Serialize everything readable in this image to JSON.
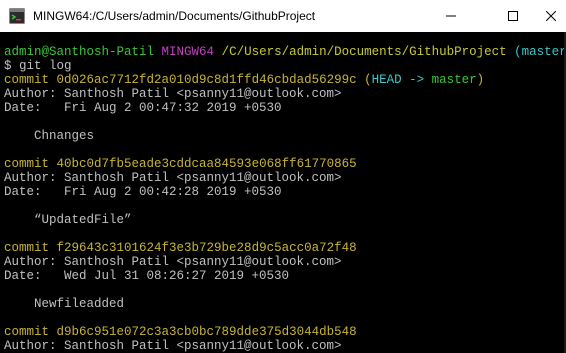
{
  "window": {
    "title": "MINGW64:/C/Users/admin/Documents/GithubProject",
    "icon": "git-bash-icon",
    "controls": [
      "minimize-icon",
      "maximize-icon",
      "close-icon"
    ]
  },
  "prompt": {
    "user_host": "admin@Santhosh-Patil",
    "shell": "MINGW64",
    "path": "/C/Users/admin/Documents/GithubProject",
    "branch": "(master)",
    "symbol": "$",
    "command": "git log"
  },
  "commits": [
    {
      "commit_label": "commit",
      "hash": "0d026ac7712fd2a010d9c8d1ffd46cbdad56299c",
      "ref_open": "(",
      "ref_head": "HEAD -> master",
      "ref_close": ")",
      "author": "Author: Santhosh Patil <psanny11@outlook.com>",
      "date": "Date:   Fri Aug 2 00:47:32 2019 +0530",
      "message": "    Chnanges"
    },
    {
      "commit_label": "commit",
      "hash": "40bc0d7fb5eade3cddcaa84593e068ff61770865",
      "author": "Author: Santhosh Patil <psanny11@outlook.com>",
      "date": "Date:   Fri Aug 2 00:42:28 2019 +0530",
      "message": "    “UpdatedFile”"
    },
    {
      "commit_label": "commit",
      "hash": "f29643c3101624f3e3b729be28d9c5acc0a72f48",
      "author": "Author: Santhosh Patil <psanny11@outlook.com>",
      "date": "Date:   Wed Jul 31 08:26:27 2019 +0530",
      "message": "    Newfileadded"
    },
    {
      "commit_label": "commit",
      "hash": "d9b6c951e072c3a3cb0bc789dde375d3044db548",
      "author": "Author: Santhosh Patil <psanny11@outlook.com>"
    }
  ],
  "colors": {
    "background": "#000000",
    "text": "#c0c0c0",
    "user_host": "#37c837",
    "shell": "#c140c1",
    "path": "#c8c832",
    "branch": "#37c8c8",
    "commit_hash": "#c8b432",
    "head_ref": "#37c8c8",
    "master_ref": "#37c837"
  }
}
